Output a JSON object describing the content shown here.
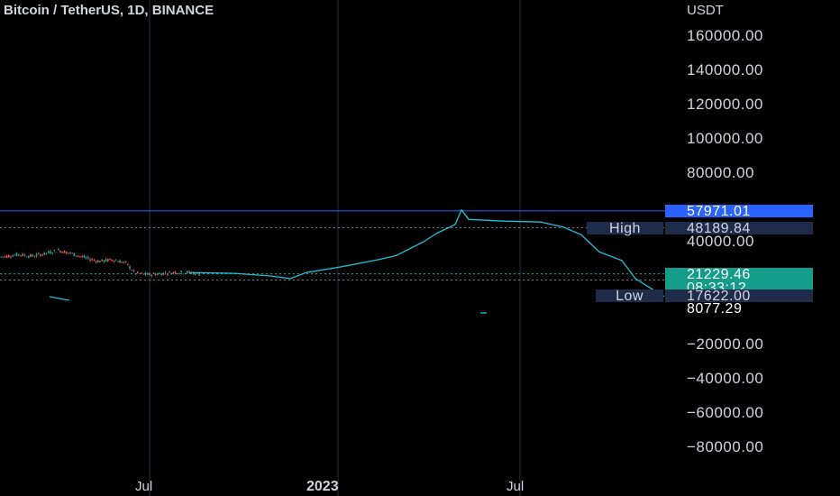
{
  "header": {
    "symbol": "Bitcoin / TetherUS, 1D, BINANCE",
    "axis_unit": "USDT"
  },
  "colors": {
    "background": "#000000",
    "grid": "#2a2e39",
    "up_candle": "#26a69a",
    "down_candle": "#ef5350",
    "projection": "#20c0d8",
    "horizontal_line": "#2962ff",
    "dotted": "#787b86"
  },
  "chart_data": {
    "type": "line",
    "title": "Bitcoin / TetherUS, 1D, BINANCE",
    "y_unit": "USDT",
    "ylim": [
      -88000,
      168000
    ],
    "x_ticks": [
      "Jul",
      "2023",
      "Jul"
    ],
    "y_ticks": [
      "160000.00",
      "140000.00",
      "120000.00",
      "100000.00",
      "80000.00",
      "40000.00",
      "−20000.00",
      "−40000.00",
      "−60000.00",
      "−80000.00"
    ],
    "grid": true,
    "series": [
      {
        "values": [
          [
            0,
            31000
          ],
          [
            20,
            32500
          ],
          [
            35,
            31500
          ],
          [
            50,
            33000
          ],
          [
            65,
            35000
          ],
          [
            80,
            33000
          ],
          [
            95,
            30500
          ],
          [
            110,
            28500
          ],
          [
            125,
            29500
          ],
          [
            140,
            27500
          ],
          [
            150,
            21500
          ],
          [
            165,
            20800
          ],
          [
            180,
            21500
          ],
          [
            195,
            22200
          ],
          [
            210,
            22000
          ],
          [
            222,
            20800
          ]
        ]
      },
      {
        "values": [
          [
            210,
            22000
          ],
          [
            260,
            21500
          ],
          [
            300,
            20000
          ],
          [
            322,
            18500
          ],
          [
            340,
            22000
          ],
          [
            380,
            25500
          ],
          [
            420,
            29500
          ],
          [
            440,
            32000
          ],
          [
            470,
            40000
          ],
          [
            485,
            45000
          ],
          [
            505,
            50000
          ],
          [
            512,
            58500
          ],
          [
            520,
            53000
          ],
          [
            560,
            52000
          ],
          [
            600,
            51500
          ],
          [
            625,
            48500
          ],
          [
            645,
            44000
          ],
          [
            665,
            34000
          ],
          [
            690,
            29000
          ],
          [
            705,
            18500
          ],
          [
            720,
            13500
          ],
          [
            737,
            8077.29
          ]
        ]
      }
    ],
    "horizontal_line": 57971.01,
    "high": 48189.84,
    "low": 17622.0,
    "current_price": 21229.46,
    "countdown": "08:33:12",
    "last_visible_value": 8077.29
  },
  "tags": {
    "line_value": "57971.01",
    "high_label": "High",
    "high_value": "48189.84",
    "price_value": "21229.46",
    "countdown": "08:33:12",
    "low_label": "Low",
    "low_value": "17622.00",
    "projection_end_value": "8077.29"
  }
}
